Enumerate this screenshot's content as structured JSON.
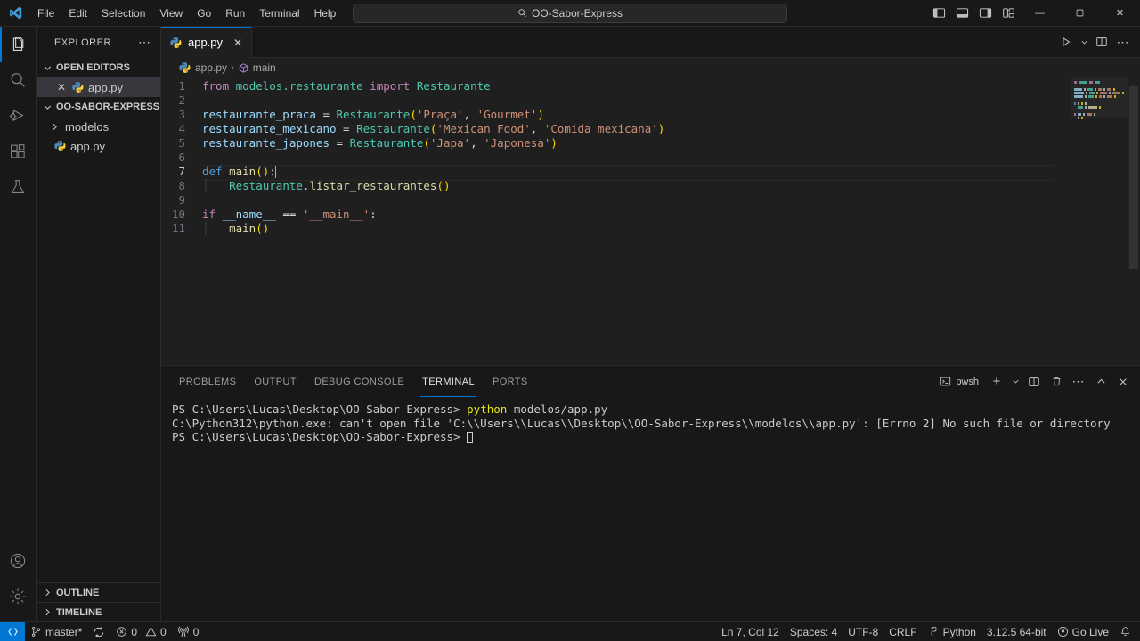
{
  "titlebar": {
    "menus": [
      "File",
      "Edit",
      "Selection",
      "View",
      "Go",
      "Run",
      "Terminal",
      "Help"
    ],
    "search_value": "OO-Sabor-Express",
    "back_icon": "arrow-left-icon",
    "forward_icon": "arrow-right-icon",
    "layout_buttons": [
      "toggle-primary-sidebar-icon",
      "toggle-panel-icon",
      "toggle-secondary-sidebar-icon",
      "customize-layout-icon"
    ],
    "window_controls": {
      "minimize": "—",
      "maximize": "❐",
      "close": "✕"
    }
  },
  "activitybar": {
    "items": [
      {
        "name": "explorer",
        "icon": "files-icon",
        "active": true
      },
      {
        "name": "search",
        "icon": "search-icon",
        "active": false
      },
      {
        "name": "run-and-debug",
        "icon": "debug-icon",
        "active": false
      },
      {
        "name": "extensions",
        "icon": "extensions-icon",
        "active": false
      },
      {
        "name": "testing",
        "icon": "beaker-icon",
        "active": false
      }
    ],
    "bottom": [
      {
        "name": "accounts",
        "icon": "account-icon"
      },
      {
        "name": "manage",
        "icon": "gear-icon"
      }
    ]
  },
  "sidebar": {
    "title": "EXPLORER",
    "more_actions": "⋯",
    "sections": [
      {
        "label": "OPEN EDITORS",
        "expanded": true,
        "items": [
          {
            "label": "app.py",
            "icon": "python-file-icon",
            "selected": true,
            "close": "✕"
          }
        ]
      },
      {
        "label": "OO-SABOR-EXPRESS",
        "expanded": true,
        "items": [
          {
            "label": "modelos",
            "icon": "folder-icon",
            "selected": false
          },
          {
            "label": "app.py",
            "icon": "python-file-icon",
            "selected": false
          }
        ]
      }
    ],
    "bottom_sections": [
      {
        "label": "OUTLINE"
      },
      {
        "label": "TIMELINE"
      }
    ]
  },
  "editor": {
    "tabs": [
      {
        "label": "app.py",
        "icon": "python-file-icon",
        "active": true,
        "close": "✕"
      }
    ],
    "tab_actions": [
      "run-python-file-icon",
      "chevron-down-icon",
      "split-editor-icon",
      "more-actions-icon"
    ],
    "breadcrumb": [
      {
        "label": "app.py",
        "icon": "python-file-icon"
      },
      {
        "label": "main",
        "icon": "symbol-method-icon"
      }
    ],
    "breadcrumb_separator": "›",
    "lines": [
      {
        "num": "1",
        "tokens": [
          {
            "t": "from ",
            "c": "t-kw2"
          },
          {
            "t": "modelos.restaurante",
            "c": "t-mod"
          },
          {
            "t": " import ",
            "c": "t-kw2"
          },
          {
            "t": "Restaurante",
            "c": "t-mod"
          }
        ]
      },
      {
        "num": "2",
        "tokens": []
      },
      {
        "num": "3",
        "tokens": [
          {
            "t": "restaurante_praca",
            "c": "t-var"
          },
          {
            "t": " = ",
            "c": "t-op"
          },
          {
            "t": "Restaurante",
            "c": "t-cls"
          },
          {
            "t": "(",
            "c": "t-paren"
          },
          {
            "t": "'Praça'",
            "c": "t-str"
          },
          {
            "t": ", ",
            "c": "t-op"
          },
          {
            "t": "'Gourmet'",
            "c": "t-str"
          },
          {
            "t": ")",
            "c": "t-paren"
          }
        ]
      },
      {
        "num": "4",
        "tokens": [
          {
            "t": "restaurante_mexicano",
            "c": "t-var"
          },
          {
            "t": " = ",
            "c": "t-op"
          },
          {
            "t": "Restaurante",
            "c": "t-cls"
          },
          {
            "t": "(",
            "c": "t-paren"
          },
          {
            "t": "'Mexican Food'",
            "c": "t-str"
          },
          {
            "t": ", ",
            "c": "t-op"
          },
          {
            "t": "'Comida mexicana'",
            "c": "t-str"
          },
          {
            "t": ")",
            "c": "t-paren"
          }
        ]
      },
      {
        "num": "5",
        "tokens": [
          {
            "t": "restaurante_japones",
            "c": "t-var"
          },
          {
            "t": " = ",
            "c": "t-op"
          },
          {
            "t": "Restaurante",
            "c": "t-cls"
          },
          {
            "t": "(",
            "c": "t-paren"
          },
          {
            "t": "'Japa'",
            "c": "t-str"
          },
          {
            "t": ", ",
            "c": "t-op"
          },
          {
            "t": "'Japonesa'",
            "c": "t-str"
          },
          {
            "t": ")",
            "c": "t-paren"
          }
        ]
      },
      {
        "num": "6",
        "tokens": []
      },
      {
        "num": "7",
        "tokens": [
          {
            "t": "def ",
            "c": "t-kw"
          },
          {
            "t": "main",
            "c": "t-fn"
          },
          {
            "t": "()",
            "c": "t-paren"
          },
          {
            "t": ":",
            "c": "t-op"
          }
        ],
        "current": true,
        "cursor": true
      },
      {
        "num": "8",
        "tokens": [
          {
            "t": "    ",
            "c": "ind-guide",
            "guide": true
          },
          {
            "t": "Restaurante",
            "c": "t-cls"
          },
          {
            "t": ".",
            "c": "t-op"
          },
          {
            "t": "listar_restaurantes",
            "c": "t-fn"
          },
          {
            "t": "()",
            "c": "t-paren"
          }
        ]
      },
      {
        "num": "9",
        "tokens": []
      },
      {
        "num": "10",
        "tokens": [
          {
            "t": "if ",
            "c": "t-kw2"
          },
          {
            "t": "__name__",
            "c": "t-var"
          },
          {
            "t": " == ",
            "c": "t-op"
          },
          {
            "t": "'__main__'",
            "c": "t-str"
          },
          {
            "t": ":",
            "c": "t-op"
          }
        ]
      },
      {
        "num": "11",
        "tokens": [
          {
            "t": "    ",
            "c": "ind-guide",
            "guide": true
          },
          {
            "t": "main",
            "c": "t-fn"
          },
          {
            "t": "()",
            "c": "t-paren"
          }
        ]
      }
    ]
  },
  "panel": {
    "tabs": [
      {
        "label": "PROBLEMS",
        "active": false
      },
      {
        "label": "OUTPUT",
        "active": false
      },
      {
        "label": "DEBUG CONSOLE",
        "active": false
      },
      {
        "label": "TERMINAL",
        "active": true
      },
      {
        "label": "PORTS",
        "active": false
      }
    ],
    "shell_label": "pwsh",
    "actions": [
      "new-terminal-icon",
      "chevron-down-icon",
      "split-terminal-icon",
      "kill-terminal-icon",
      "more-actions-icon",
      "maximize-panel-icon",
      "close-panel-icon"
    ],
    "terminal_lines": [
      {
        "segments": [
          {
            "t": "PS C:\\Users\\Lucas\\Desktop\\OO-Sabor-Express> ",
            "c": "term-normal"
          },
          {
            "t": "python",
            "c": "term-yellow"
          },
          {
            "t": " modelos/app.py",
            "c": "term-normal"
          }
        ]
      },
      {
        "segments": [
          {
            "t": "C:\\Python312\\python.exe: can't open file 'C:\\\\Users\\\\Lucas\\\\Desktop\\\\OO-Sabor-Express\\\\modelos\\\\app.py': [Errno 2] No such file or directory",
            "c": "term-normal"
          }
        ]
      },
      {
        "segments": [
          {
            "t": "PS C:\\Users\\Lucas\\Desktop\\OO-Sabor-Express> ",
            "c": "term-normal"
          }
        ],
        "cursor": true
      }
    ]
  },
  "statusbar": {
    "remote_icon": "remote-window-icon",
    "left_items": [
      {
        "name": "source-control-branch",
        "icon": "git-branch-icon",
        "label": "master*"
      },
      {
        "name": "sync-changes",
        "icon": "sync-icon",
        "label": ""
      },
      {
        "name": "problems-errors",
        "icon": "error-icon",
        "label": "0"
      },
      {
        "name": "problems-warnings",
        "icon": "warning-icon",
        "label": "0"
      },
      {
        "name": "ports-forwarded",
        "icon": "radio-tower-icon",
        "label": "0"
      }
    ],
    "right_items": [
      {
        "name": "editor-position",
        "label": "Ln 7, Col 12"
      },
      {
        "name": "indentation",
        "label": "Spaces: 4"
      },
      {
        "name": "encoding",
        "label": "UTF-8"
      },
      {
        "name": "eol",
        "label": "CRLF"
      },
      {
        "name": "language-mode",
        "icon": "python-logo-icon",
        "label": "Python"
      },
      {
        "name": "python-interpreter",
        "label": "3.12.5 64-bit"
      },
      {
        "name": "go-live",
        "icon": "broadcast-icon",
        "label": "Go Live"
      },
      {
        "name": "notifications",
        "icon": "bell-icon",
        "label": ""
      }
    ]
  },
  "colors": {
    "accent": "#0078d4",
    "background": "#1f1f1f",
    "chrome": "#181818",
    "text": "#cccccc"
  }
}
